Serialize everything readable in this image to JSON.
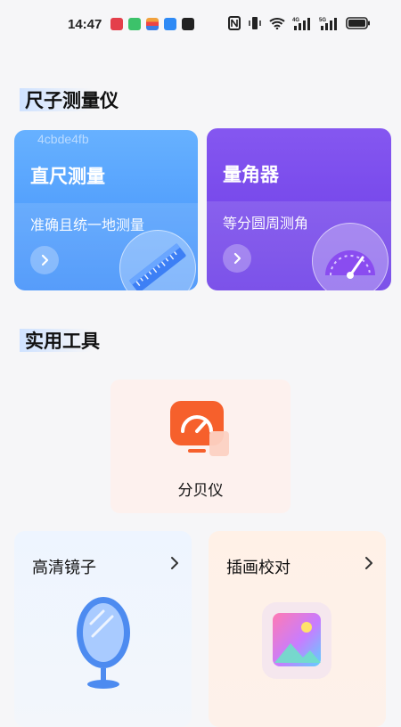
{
  "status_bar": {
    "time": "14:47",
    "notification_icons": [
      "app-red",
      "app-green",
      "app-flag",
      "app-blue",
      "app-dark"
    ],
    "system_icons": [
      "nfc-icon",
      "vibrate-icon",
      "wifi-icon",
      "signal-4g-icon",
      "signal-5g-icon",
      "battery-icon"
    ]
  },
  "sections": {
    "measure_title": "尺子测量仪",
    "tools_title": "实用工具"
  },
  "watermark": "4cbde4fb",
  "cards": {
    "ruler": {
      "title": "直尺测量",
      "subtitle": "准确且统一地测量"
    },
    "protractor": {
      "title": "量角器",
      "subtitle": "等分圆周测角"
    }
  },
  "tools": {
    "decibel": {
      "label": "分贝仪"
    },
    "mirror": {
      "label": "高清镜子"
    },
    "illustration": {
      "label": "插画校对"
    }
  },
  "colors": {
    "ruler_card": "#4a98fb",
    "protractor_card": "#7447ea",
    "decibel_icon": "#f7652b",
    "accent_highlight": "#cfe2ff"
  }
}
